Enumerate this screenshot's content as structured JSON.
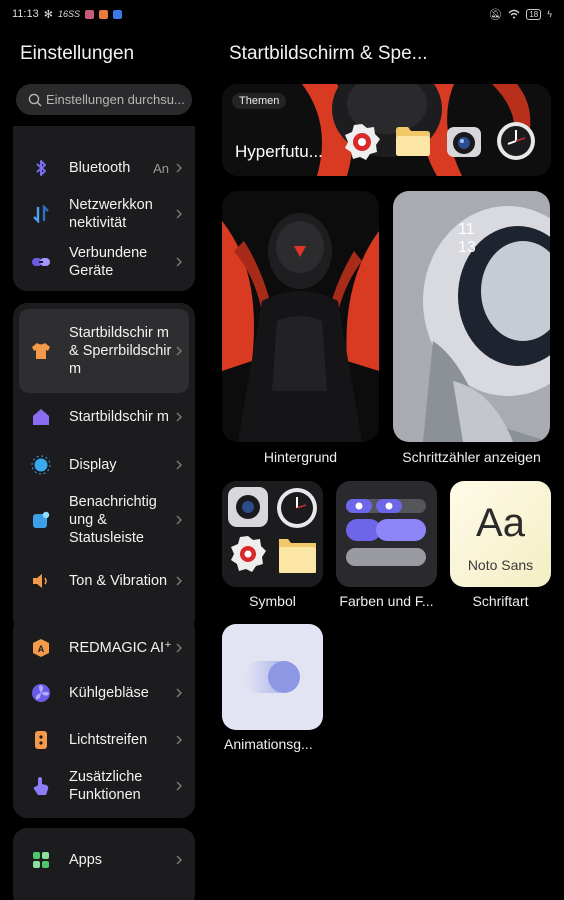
{
  "status_bar": {
    "time": "11:13",
    "left_text": "16SS",
    "battery": "18"
  },
  "sidebar": {
    "title": "Einstellungen",
    "search_placeholder": "Einstellungen durchsu...",
    "items": [
      {
        "label": "Bluetooth",
        "value": "An",
        "icon": "bluetooth-icon",
        "color": "#7b6cf6"
      },
      {
        "label": "Netzwerkkon nektivität",
        "icon": "network-icon",
        "color": "#4aa3f0"
      },
      {
        "label": "Verbundene Geräte",
        "icon": "link-icon",
        "color": "#8b7cf8"
      },
      {
        "label": "Startbildschir m & Sperrbildschir m",
        "icon": "tshirt-icon",
        "color": "#f39a4b",
        "selected": true
      },
      {
        "label": "Startbildschir m",
        "icon": "home-icon",
        "color": "#8b6cf0"
      },
      {
        "label": "Display",
        "icon": "sun-icon",
        "color": "#39a9f0"
      },
      {
        "label": "Benachrichtig ung & Statusleiste",
        "icon": "notification-icon",
        "color": "#3ba0e8"
      },
      {
        "label": "Ton & Vibration",
        "icon": "speaker-icon",
        "color": "#f39a4b"
      },
      {
        "label": "REDMAGIC AI⁺",
        "icon": "ai-icon",
        "color": "#f39a4b"
      },
      {
        "label": "Kühlgebläse",
        "icon": "fan-icon",
        "color": "#8b7cf8"
      },
      {
        "label": "Lichtstreifen",
        "icon": "light-strip-icon",
        "color": "#f39a4b"
      },
      {
        "label": "Zusätzliche Funktionen",
        "icon": "hand-icon",
        "color": "#8b7cf8"
      },
      {
        "label": "Apps",
        "icon": "apps-icon",
        "color": "#4cc86a"
      }
    ]
  },
  "main": {
    "title": "Startbildschirm & Spe...",
    "theme_badge": "Themen",
    "theme_name": "Hyperfutu...",
    "tiles": [
      {
        "label": "Hintergrund"
      },
      {
        "label": "Schrittzähler anzeigen"
      },
      {
        "label": "Symbol"
      },
      {
        "label": "Farben und F..."
      },
      {
        "label": "Schriftart"
      },
      {
        "label": "Animationsg..."
      }
    ],
    "font_preview": {
      "glyph": "Aa",
      "font_name": "Noto Sans"
    },
    "lock_time": {
      "hours": "11",
      "minutes": "13"
    }
  }
}
